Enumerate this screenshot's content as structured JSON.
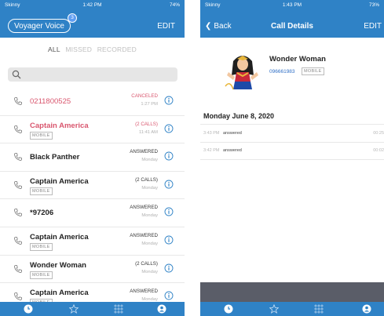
{
  "left": {
    "status": {
      "carrier": "Skinny",
      "time": "1:42 PM",
      "battery": "74%"
    },
    "header": {
      "account_label": "Voyager Voice",
      "badge_count": "3",
      "edit_label": "EDIT"
    },
    "filters": [
      {
        "label": "ALL",
        "active": true
      },
      {
        "label": "MISSED",
        "active": false
      },
      {
        "label": "RECORDED",
        "active": false
      }
    ],
    "calls": [
      {
        "name": "0211800525",
        "tag": "",
        "status": "CANCELED",
        "when": "1:27 PM",
        "red": true
      },
      {
        "name": "Captain America",
        "tag": "MOBILE",
        "status": "(2 CALLS)",
        "when": "11:41 AM",
        "red": true
      },
      {
        "name": "Black Panther",
        "tag": "",
        "status": "ANSWERED",
        "when": "Monday",
        "red": false
      },
      {
        "name": "Captain America",
        "tag": "MOBILE",
        "status": "(2 CALLS)",
        "when": "Monday",
        "red": false
      },
      {
        "name": "*97206",
        "tag": "",
        "status": "ANSWERED",
        "when": "Monday",
        "red": false
      },
      {
        "name": "Captain America",
        "tag": "MOBILE",
        "status": "ANSWERED",
        "when": "Monday",
        "red": false
      },
      {
        "name": "Wonder Woman",
        "tag": "MOBILE",
        "status": "(2 CALLS)",
        "when": "Monday",
        "red": false
      },
      {
        "name": "Captain America",
        "tag": "MOBILE",
        "status": "ANSWERED",
        "when": "Monday",
        "red": false
      }
    ]
  },
  "right": {
    "status": {
      "carrier": "Skinny",
      "time": "1:43 PM",
      "battery": "73%"
    },
    "header": {
      "back_label": "Back",
      "title": "Call Details",
      "edit_label": "EDIT"
    },
    "contact": {
      "name": "Wonder Woman",
      "number": "096661983",
      "tag": "MOBILE"
    },
    "date_heading": "Monday June 8, 2020",
    "entries": [
      {
        "time": "3:43 PM",
        "status": "answered",
        "duration": "00:25"
      },
      {
        "time": "3:42 PM",
        "status": "answered",
        "duration": "00:02"
      }
    ]
  },
  "colors": {
    "accent": "#2f82c6",
    "missed": "#d9566e",
    "link": "#2f6fc6",
    "band": "#5a5d68"
  },
  "icons": {
    "tabs": [
      "recent-calls-icon",
      "favorites-star-icon",
      "keypad-icon",
      "contact-icon"
    ]
  }
}
